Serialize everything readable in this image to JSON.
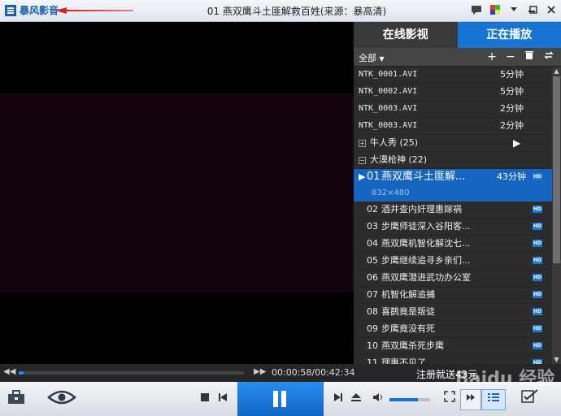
{
  "app": {
    "logo_text": "暴风影音",
    "window_title": "01 燕双鹰斗土匪解救百姓(来源：暴高清)"
  },
  "tabs": {
    "online": "在线影视",
    "playing": "正在播放"
  },
  "filter": {
    "label": "全部"
  },
  "files": [
    {
      "name": "NTK_0001.AVI",
      "duration": "5分钟"
    },
    {
      "name": "NTK_0002.AVI",
      "duration": "5分钟"
    },
    {
      "name": "NTK_0003.AVI",
      "duration": "2分钟"
    },
    {
      "name": "NTK_0003.AVI",
      "duration": "2分钟"
    }
  ],
  "groups": [
    {
      "box": "+",
      "name": "牛人秀 (25)"
    },
    {
      "box": "−",
      "name": "大漠枪神 (22)"
    }
  ],
  "selected": {
    "num": "01",
    "name": "燕双鹰斗土匪解...",
    "duration": "43分钟",
    "resolution": "832×480",
    "badge": "HD"
  },
  "episodes": [
    {
      "num": "02",
      "name": "酒井查内奸理惠嫁祸",
      "badge": "HD"
    },
    {
      "num": "03",
      "name": "步鹰师徒深入谷阳客...",
      "badge": "HD"
    },
    {
      "num": "04",
      "name": "燕双鹰机智化解沈七...",
      "badge": "HD"
    },
    {
      "num": "05",
      "name": "步鹰继续追寻乡亲们...",
      "badge": "HD"
    },
    {
      "num": "06",
      "name": "燕双鹰潜进武功办公室",
      "badge": "HD"
    },
    {
      "num": "07",
      "name": "机智化解追捕",
      "badge": "HD"
    },
    {
      "num": "08",
      "name": "喜鹊竟是叛徒",
      "badge": "HD"
    },
    {
      "num": "09",
      "name": "步鹰竟没有死",
      "badge": "HD"
    },
    {
      "num": "10",
      "name": "燕双鹰杀死步鹰",
      "badge": "HD"
    },
    {
      "num": "11",
      "name": "理惠不见了",
      "badge": "HD"
    }
  ],
  "playback": {
    "time": "00:00:58/00:42:34",
    "progress": 0.023,
    "volume": 0.7
  },
  "notice": "注册就送43元",
  "watermark": "Baidu 经验",
  "colors": {
    "accent": "#1774d2",
    "arrow": "#e02020"
  }
}
